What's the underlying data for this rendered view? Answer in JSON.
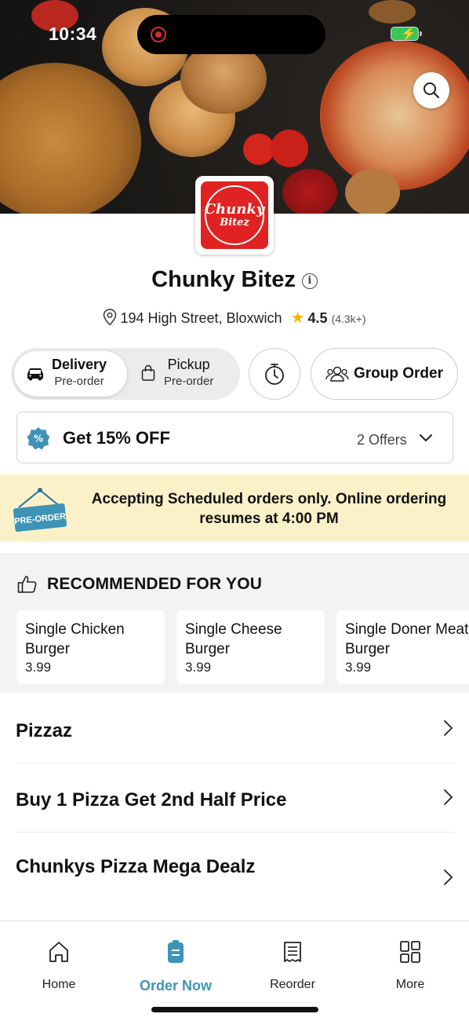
{
  "status_bar": {
    "time": "10:34"
  },
  "restaurant": {
    "name": "Chunky Bitez",
    "logo_text_line1": "Chunky",
    "logo_text_line2": "Bitez",
    "address": "194 High Street, Bloxwich",
    "rating": "4.5",
    "rating_count": "(4.3k+)"
  },
  "order_mode": {
    "delivery_label": "Delivery",
    "delivery_sub": "Pre-order",
    "pickup_label": "Pickup",
    "pickup_sub": "Pre-order",
    "selected": "Delivery"
  },
  "group_order_label": "Group Order",
  "offers": {
    "title": "Get 15% OFF",
    "count": "2 Offers"
  },
  "banner": {
    "sign_text": "PRE-ORDER",
    "message": "Accepting Scheduled orders only. Online ordering resumes at 4:00 PM"
  },
  "recommended": {
    "heading": "RECOMMENDED FOR YOU",
    "items": [
      {
        "name": "Single Chicken Burger",
        "price": "3.99"
      },
      {
        "name": "Single Cheese Burger",
        "price": "3.99"
      },
      {
        "name": "Single Doner Meat Burger",
        "price": "3.99"
      }
    ]
  },
  "categories": [
    {
      "label": "Pizzaz"
    },
    {
      "label": "Buy 1 Pizza Get 2nd Half Price"
    },
    {
      "label": "Chunkys Pizza Mega Dealz"
    }
  ],
  "bottom_nav": {
    "items": [
      {
        "label": "Home",
        "icon": "home-icon"
      },
      {
        "label": "Order Now",
        "icon": "order-icon",
        "active": true
      },
      {
        "label": "Reorder",
        "icon": "receipt-icon"
      },
      {
        "label": "More",
        "icon": "grid-icon"
      }
    ]
  },
  "colors": {
    "accent": "#3d94b6",
    "brand_red": "#e12222",
    "banner_bg": "#fbf1c9",
    "rating_star": "#f5b301"
  }
}
